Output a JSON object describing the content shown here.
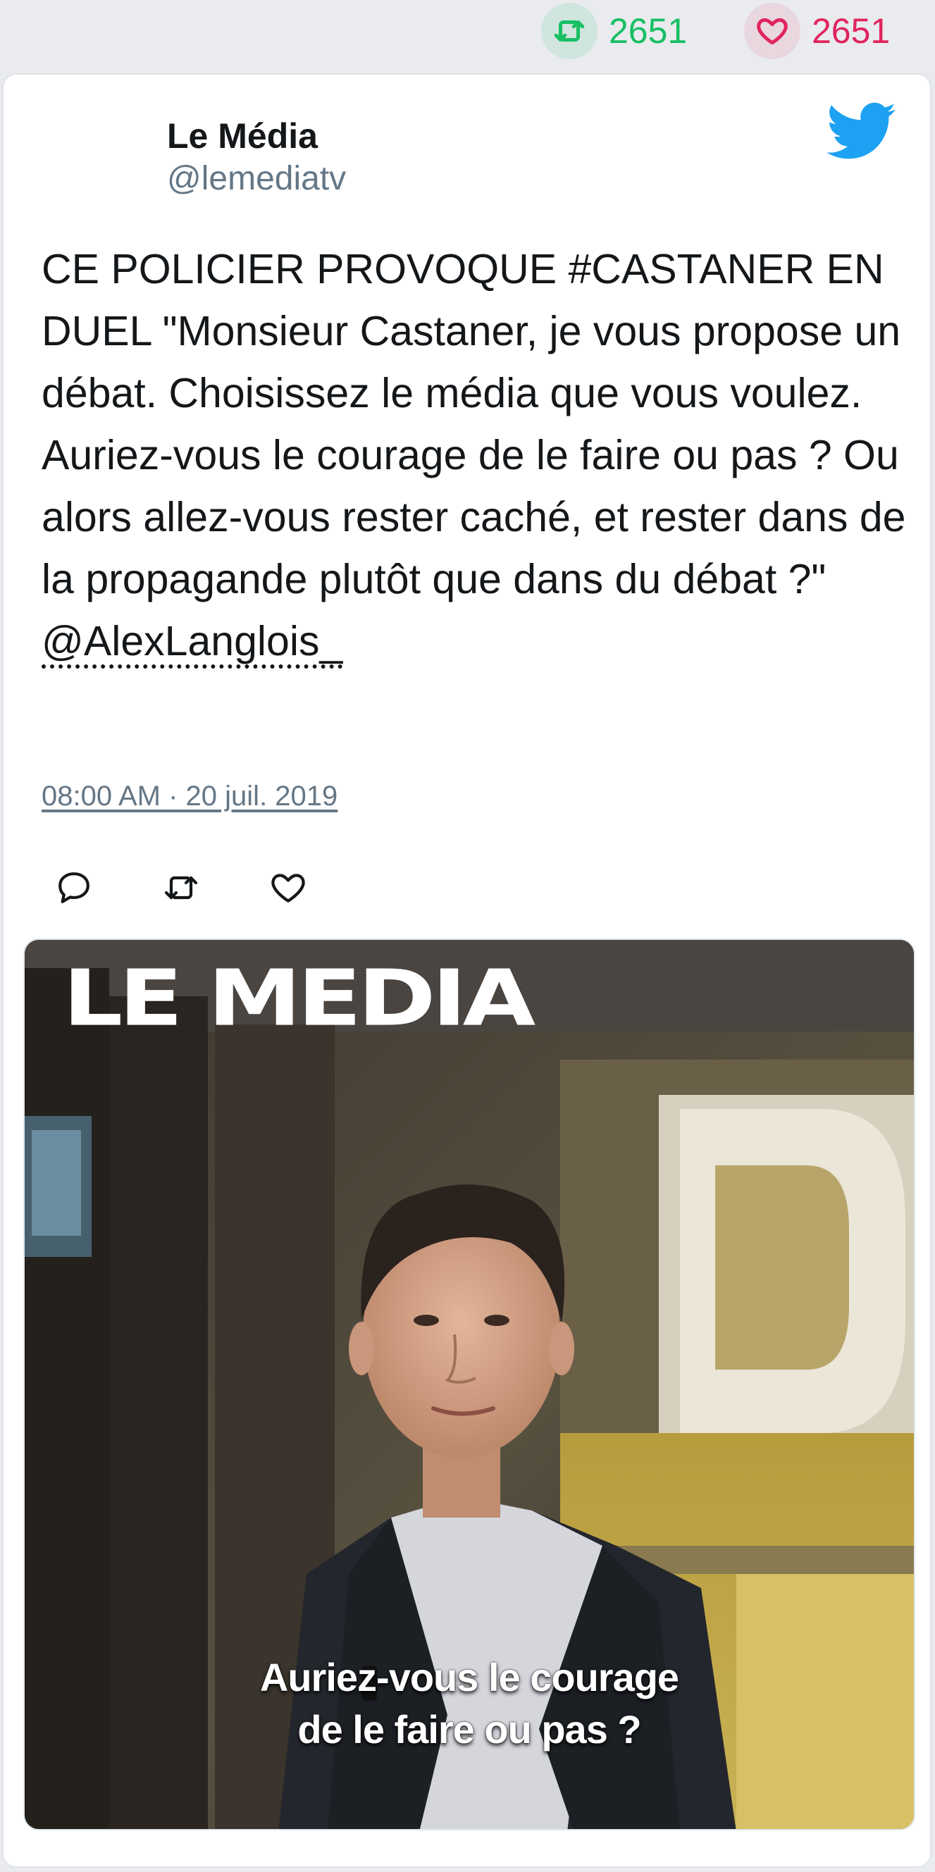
{
  "stats": {
    "retweets": "2651",
    "likes": "2651",
    "retweet_icon": "retweet-icon",
    "like_icon": "heart-icon",
    "retweet_color": "#17bf63",
    "like_color": "#e0245e"
  },
  "tweet": {
    "author_name": "Le Média",
    "author_handle": "@lemediatv",
    "text": "CE POLICIER PROVOQUE #CASTANER EN DUEL \"Monsieur Castaner, je vous propose un débat. Choisissez le média que vous voulez. Auriez-vous le courage de le faire ou pas ? Ou alors allez-vous rester caché, et rester dans de la propagande plutôt que dans du débat ?\" ",
    "mention": "@AlexLanglois_",
    "timestamp": "08:00 AM · 20 juil. 2019",
    "brand_color": "#1da1f2"
  },
  "actions": [
    "reply-icon",
    "retweet-icon",
    "heart-icon"
  ],
  "media": {
    "logo": "LE MEDIA",
    "caption_line1": "Auriez-vous le courage",
    "caption_line2": "de le faire ou pas ?"
  }
}
